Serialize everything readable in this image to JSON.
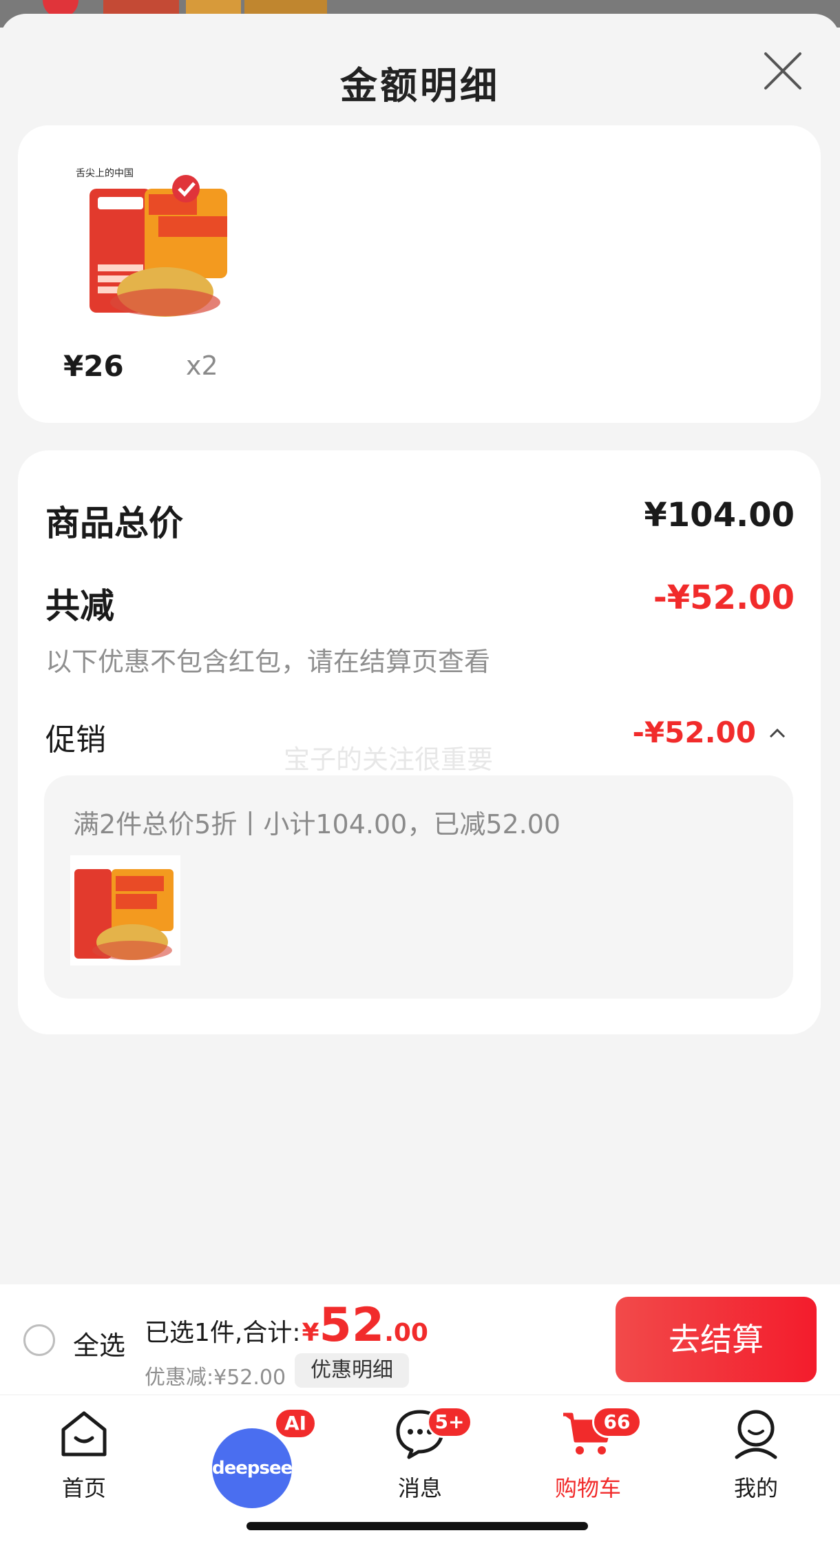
{
  "sheet": {
    "title": "金额明细"
  },
  "product": {
    "price": "¥26",
    "qty": "x2",
    "image_icon": "roast-chicken-product-image"
  },
  "detail": {
    "total_label": "商品总价",
    "total_value": "¥104.00",
    "discount_label": "共减",
    "discount_value": "-¥52.00",
    "discount_note": "以下优惠不包含红包，请在结算页查看",
    "promo_label": "促销",
    "promo_value": "-¥52.00",
    "watermark": "宝子的关注很重要",
    "promo_text": "满2件总价5折丨小计104.00，已减52.00"
  },
  "checkout": {
    "select_all": "全选",
    "selected_summary": "已选1件,合计:",
    "currency": "¥",
    "total_int": "52",
    "total_dec": ".00",
    "saved": "优惠减:¥52.00",
    "detail_button": "优惠明细",
    "pay_button": "去结算"
  },
  "tabs": [
    {
      "label": "首页",
      "icon": "home-icon"
    },
    {
      "label": "deepseek",
      "icon": "deepseek-icon",
      "badge": "AI"
    },
    {
      "label": "消息",
      "icon": "message-icon",
      "badge": "5+"
    },
    {
      "label": "购物车",
      "icon": "cart-icon",
      "badge": "66",
      "active": true
    },
    {
      "label": "我的",
      "icon": "profile-icon"
    }
  ],
  "colors": {
    "accent": "#f12b2b",
    "deepseek_blue": "#4a6ef0",
    "background": "#f4f4f4"
  }
}
